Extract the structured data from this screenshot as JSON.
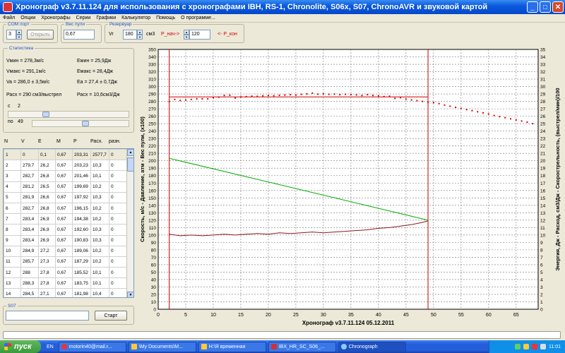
{
  "window": {
    "title": "Хронограф v3.7.11.124  для использования с хронографами  IBH, RS-1, Chronolite, S06x, S07, ChronoAVR и звуковой картой"
  },
  "menu": [
    "Файл",
    "Опции",
    "Хронографы",
    "Серии",
    "Графики",
    "Калькулятор",
    "Помощь",
    "О программе..."
  ],
  "com": {
    "legend": "COM порт",
    "value": "3",
    "open_label": "Открыть"
  },
  "weight": {
    "legend": "Вес пули",
    "value": "0,67"
  },
  "reservoir": {
    "legend": "Резервуар",
    "v_label": "Vr",
    "volume": "180",
    "unit": "см3",
    "p_start_label": "P_нач->",
    "p_start": "120",
    "p_end_label": "<- P_кон"
  },
  "stats": {
    "legend": "Статистика",
    "vmin": "Vмин = 278,3м/с",
    "vmax": "Vмакс = 291,1м/с",
    "va": "Va = 286,0 ± 3,5м/с",
    "emin": "Eмин = 25,9Дж",
    "emax": "Eмакс = 28,4Дж",
    "ea": "Ea = 27,4 ± 0,7Дж",
    "consumption": "Расх = 290 см3/выстрел",
    "consumption2": "Расх = 10,6см3/Дж",
    "from_label": "с",
    "from_value": "2",
    "to_label": "по",
    "to_value": "49"
  },
  "table": {
    "headers": [
      "N",
      "V",
      "E",
      "M",
      "P",
      "Расх.",
      "разн."
    ],
    "rows": [
      [
        "1",
        "0",
        "0,1",
        "0,67",
        "203,31",
        "2577,7",
        "0"
      ],
      [
        "2",
        "279,7",
        "26,2",
        "0,67",
        "203,23",
        "10,3",
        "0"
      ],
      [
        "3",
        "282,7",
        "26,8",
        "0,67",
        "201,46",
        "10,1",
        "0"
      ],
      [
        "4",
        "281,2",
        "26,5",
        "0,67",
        "199,69",
        "10,2",
        "0"
      ],
      [
        "5",
        "281,9",
        "26,6",
        "0,67",
        "197,92",
        "10,3",
        "0"
      ],
      [
        "6",
        "282,7",
        "26,8",
        "0,67",
        "196,15",
        "10,2",
        "0"
      ],
      [
        "7",
        "283,4",
        "26,9",
        "0,67",
        "194,38",
        "10,2",
        "0"
      ],
      [
        "8",
        "283,4",
        "26,9",
        "0,67",
        "192,60",
        "10,3",
        "0"
      ],
      [
        "9",
        "283,4",
        "26,9",
        "0,67",
        "190,83",
        "10,3",
        "0"
      ],
      [
        "10",
        "284,9",
        "27,2",
        "0,67",
        "189,06",
        "10,2",
        "0"
      ],
      [
        "11",
        "285,7",
        "27,3",
        "0,67",
        "187,29",
        "10,2",
        "0"
      ],
      [
        "12",
        "288",
        "27,8",
        "0,67",
        "185,52",
        "10,1",
        "0"
      ],
      [
        "13",
        "288,3",
        "27,8",
        "0,67",
        "183,75",
        "10,1",
        "0"
      ],
      [
        "14",
        "284,5",
        "27,1",
        "0,67",
        "181,98",
        "10,4",
        "0"
      ]
    ]
  },
  "s07": {
    "legend": "S07",
    "start_label": "Старт"
  },
  "chart_data": {
    "type": "line",
    "xlabel": "Хронограф v3.7.11.124       05.12.2011",
    "ylabel_left": "Скорость, м/с - Давление, атм - Вес пули, (х100)",
    "ylabel_right": "Энергия, Дж - Расход, см3/Дж - Скорострельность, (выстрел/мин)/100",
    "xlim": [
      0,
      69
    ],
    "ylim_left": [
      0,
      350
    ],
    "ylim_right": [
      0,
      35
    ],
    "x_ticks": [
      0,
      5,
      10,
      15,
      20,
      25,
      30,
      35,
      40,
      45,
      50,
      55,
      60,
      65
    ],
    "grid": true,
    "vlines": [
      2,
      49
    ],
    "hlines": [
      286
    ],
    "series": [
      {
        "color": "#dd0000",
        "x": [
          2,
          3,
          4,
          5,
          6,
          7,
          8,
          9,
          10,
          11,
          12,
          13,
          14,
          15,
          16,
          17,
          18,
          19,
          20,
          21,
          22,
          23,
          24,
          25,
          26,
          27,
          28,
          29,
          30,
          31,
          32,
          33,
          34,
          35,
          36,
          37,
          38,
          39,
          40,
          41,
          42,
          43,
          44,
          45,
          46,
          47,
          48,
          49,
          50,
          51,
          52,
          53,
          54,
          55,
          56,
          57,
          58,
          59,
          60,
          61,
          62,
          63,
          64,
          65,
          66,
          67,
          68
        ],
        "values": [
          279.7,
          282.7,
          281.2,
          281.9,
          282.7,
          283.4,
          283.4,
          283.4,
          284.9,
          285.7,
          288,
          288.3,
          284.5,
          286,
          286.5,
          287,
          286.8,
          287.5,
          288,
          287.6,
          288.2,
          288.5,
          289,
          288.6,
          289.5,
          290,
          291.1,
          289.7,
          290.2,
          289.5,
          289.8,
          289,
          289.6,
          289.2,
          288.7,
          288,
          289,
          288,
          287.5,
          286.5,
          287,
          284,
          285,
          283,
          282,
          281,
          280,
          279,
          278.3,
          277,
          275,
          273.5,
          272,
          270.5,
          269,
          267.5,
          266,
          264.5,
          263,
          261,
          259.5,
          258,
          256.5,
          255,
          253.5,
          252,
          250
        ]
      },
      {
        "color": "#00aa00",
        "x": [
          2,
          49
        ],
        "values": [
          203.31,
          120
        ]
      },
      {
        "color": "#8b1a1a",
        "x": [
          2,
          4,
          6,
          8,
          10,
          12,
          14,
          16,
          18,
          20,
          22,
          24,
          26,
          28,
          30,
          32,
          34,
          36,
          38,
          40,
          42,
          44,
          46,
          48,
          49
        ],
        "values": [
          101,
          99,
          100,
          99,
          100,
          101,
          100,
          101,
          102,
          101,
          103,
          102,
          103,
          104,
          103,
          104,
          105,
          106,
          107,
          109,
          110,
          112,
          114,
          117,
          119
        ]
      }
    ]
  },
  "taskbar": {
    "start_label": "пуск",
    "lang": "EN",
    "items": [
      "motorin40@mail.r...",
      "\\My Documents\\M...",
      "H:\\Я временная",
      "IBX_HR_SC_S06_...",
      "Chronograph"
    ],
    "clock": "11:01"
  }
}
